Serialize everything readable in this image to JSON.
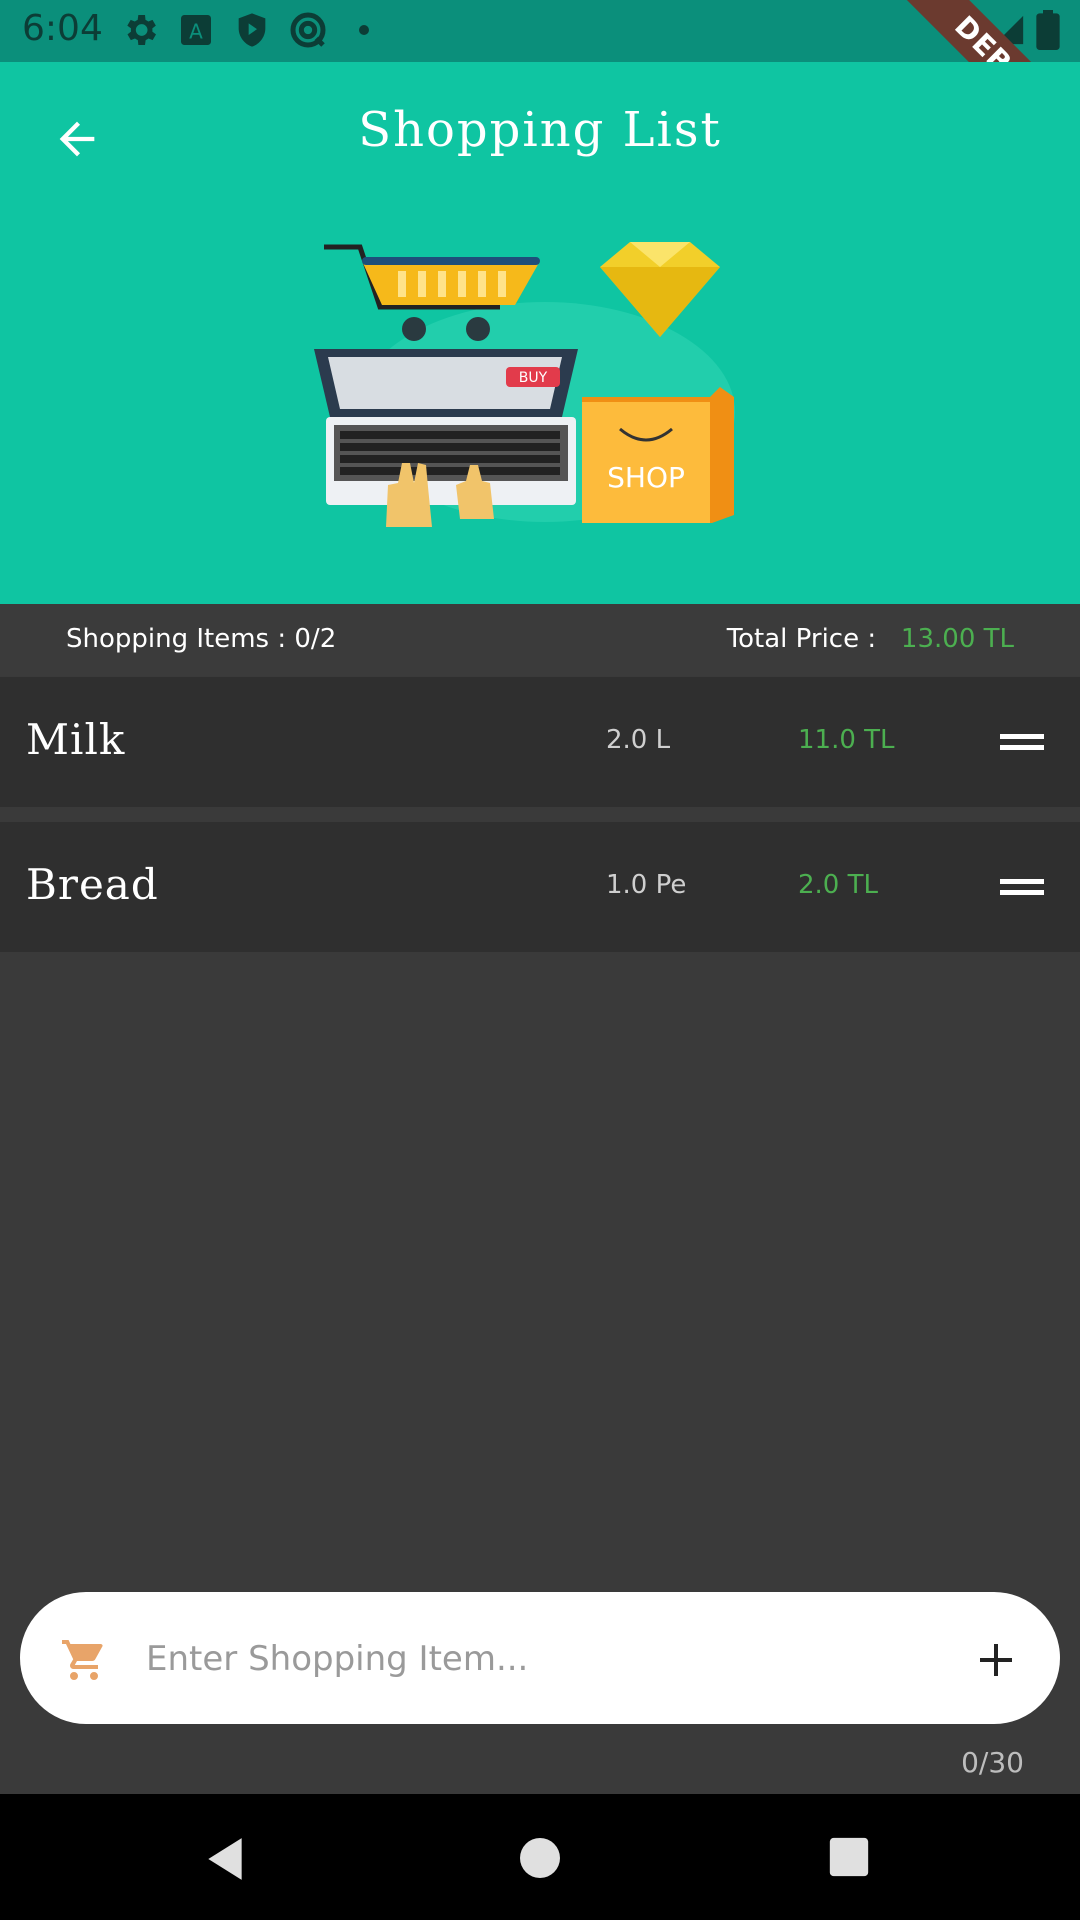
{
  "status_bar": {
    "time": "6:04",
    "debug_label": "DEBUG"
  },
  "header": {
    "title": "Shopping List"
  },
  "illustration": {
    "buy_label": "BUY",
    "shop_label": "SHOP"
  },
  "summary": {
    "items_label": "Shopping Items : 0/2",
    "total_label": "Total Price :",
    "total_value": "13.00 TL"
  },
  "items": [
    {
      "name": "Milk",
      "qty": "2.0 L",
      "price": "11.0 TL"
    },
    {
      "name": "Bread",
      "qty": "1.0 Pe",
      "price": "2.0 TL"
    }
  ],
  "input": {
    "placeholder": "Enter Shopping Item...",
    "counter": "0/30"
  },
  "colors": {
    "header_bg": "#0fc5a2",
    "status_bg": "#0b8f7b",
    "price_green": "#4caf50",
    "body_bg": "#3a3a3a",
    "item_bg": "#2f2f2f",
    "cart_icon": "#e8a469"
  }
}
